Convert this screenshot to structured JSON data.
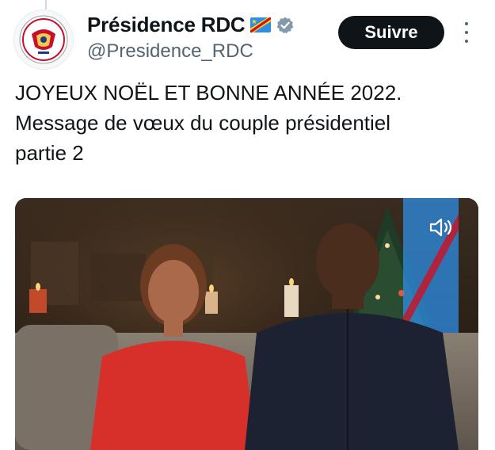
{
  "author": {
    "display_name": "Présidence RDC",
    "handle": "@Presidence_RDC"
  },
  "follow_label": "Suivre",
  "tweet": {
    "lines": [
      "JOYEUX NOËL ET BONNE ANNÉE 2022.",
      "Message de vœux du couple présidentiel",
      "partie 2"
    ]
  },
  "icons": {
    "verified": "verified-badge-icon",
    "flag": "drc-flag-emoji",
    "more": "more-options-icon",
    "mute": "speaker-muted-icon"
  },
  "colors": {
    "follow_bg": "#0f1419",
    "handle": "#536471",
    "verified": "#829aab"
  }
}
